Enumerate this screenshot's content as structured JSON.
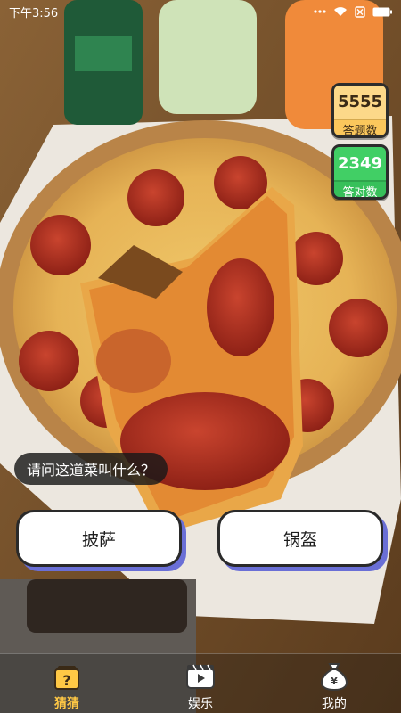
{
  "status_bar": {
    "time": "下午3:56",
    "icons": [
      "signal-dots-icon",
      "wifi-icon",
      "sim-off-icon",
      "battery-icon"
    ]
  },
  "stats": {
    "question_count": "5555",
    "question_label": "答题数",
    "correct_count": "2349",
    "correct_label": "答对数"
  },
  "question": {
    "text": "请问这道菜叫什么？"
  },
  "answers": [
    {
      "label": "披萨"
    },
    {
      "label": "锅盔"
    }
  ],
  "tabs": [
    {
      "label": "猜猜",
      "icon": "question-box-icon",
      "active": true
    },
    {
      "label": "娱乐",
      "icon": "video-play-icon",
      "active": false
    },
    {
      "label": "我的",
      "icon": "money-bag-icon",
      "active": false
    }
  ],
  "colors": {
    "accent": "#ffc845",
    "question_badge": "#fbc75c",
    "correct_badge": "#37c05a",
    "answer_shadow": "#6a6fd6"
  }
}
